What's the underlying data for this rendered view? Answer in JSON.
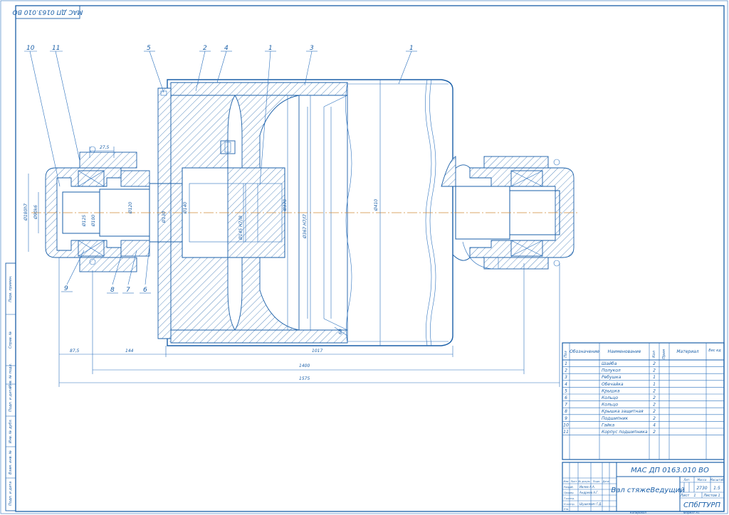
{
  "colors": {
    "ink": "#1a5fa8",
    "axis": "#d08a3a",
    "paper": "#ffffff"
  },
  "corner_code": "МАС ДП 0163.010 ВО",
  "part_callouts": [
    "1",
    "1",
    "2",
    "3",
    "4",
    "5",
    "6",
    "7",
    "8",
    "9",
    "10",
    "11"
  ],
  "diameters": [
    "Ø180h7",
    "Ø90k6",
    "Ø125",
    "Ø100",
    "Ø120",
    "Ø130",
    "Ø140",
    "Ø145 H7/l8",
    "Ø378",
    "Ø367 H7/l7",
    "Ø410"
  ],
  "dimensions": {
    "d_275": "27,5",
    "d_875": "87,5",
    "d_144": "144",
    "d_1017": "1017",
    "d_1400": "1400",
    "d_1575": "1575",
    "d_60": "60"
  },
  "spec_table": {
    "headers": [
      "Поз",
      "Обозначение",
      "Наименование",
      "Кол",
      "Прим",
      "Материал",
      "Вес ед"
    ],
    "rows": [
      {
        "pos": "1",
        "name": "Шайба",
        "qty": "2"
      },
      {
        "pos": "2",
        "name": "Полукол",
        "qty": "2"
      },
      {
        "pos": "3",
        "name": "Ребушка",
        "qty": "1"
      },
      {
        "pos": "4",
        "name": "Обечайка",
        "qty": "1"
      },
      {
        "pos": "5",
        "name": "Крышка",
        "qty": "2"
      },
      {
        "pos": "6",
        "name": "Кольцо",
        "qty": "2"
      },
      {
        "pos": "7",
        "name": "Кольцо",
        "qty": "2"
      },
      {
        "pos": "8",
        "name": "Крышка защитная",
        "qty": "2"
      },
      {
        "pos": "9",
        "name": "Подшипник",
        "qty": "2"
      },
      {
        "pos": "10",
        "name": "Гайка",
        "qty": "4"
      },
      {
        "pos": "11",
        "name": "Корпус подшипника",
        "qty": "2"
      }
    ]
  },
  "title_block": {
    "doc_number": "МАС ДП 0163.010 ВО",
    "title": "Вал стяжеВедущий",
    "org": "СПбГТУРП",
    "mass": "2730",
    "scale": "1:5",
    "sheet_count": "Листов 1",
    "role_labels": [
      "Изм",
      "Лист",
      "№ докум.",
      "Подп.",
      "Дата",
      "Разраб.",
      "Провер.",
      "Т.контр.",
      "Н.контр.",
      "Утв."
    ],
    "names": [
      "Ивлев А.А.",
      "Андреев А.Г.",
      "Шушкевич Г.Д."
    ],
    "header_labels": [
      "Лит.",
      "Масса",
      "Масштаб"
    ],
    "sheet_label": "Лист",
    "sheet_number": "1"
  },
  "bottom_labels": [
    "Копировал",
    "Формат А1"
  ],
  "left_strip_labels": [
    "Перв. примен.",
    "Справ. №",
    "Подп. и дата",
    "Инв. № дубл.",
    "Взам. инв. №",
    "Подп. и дата",
    "Инв. № подл."
  ]
}
